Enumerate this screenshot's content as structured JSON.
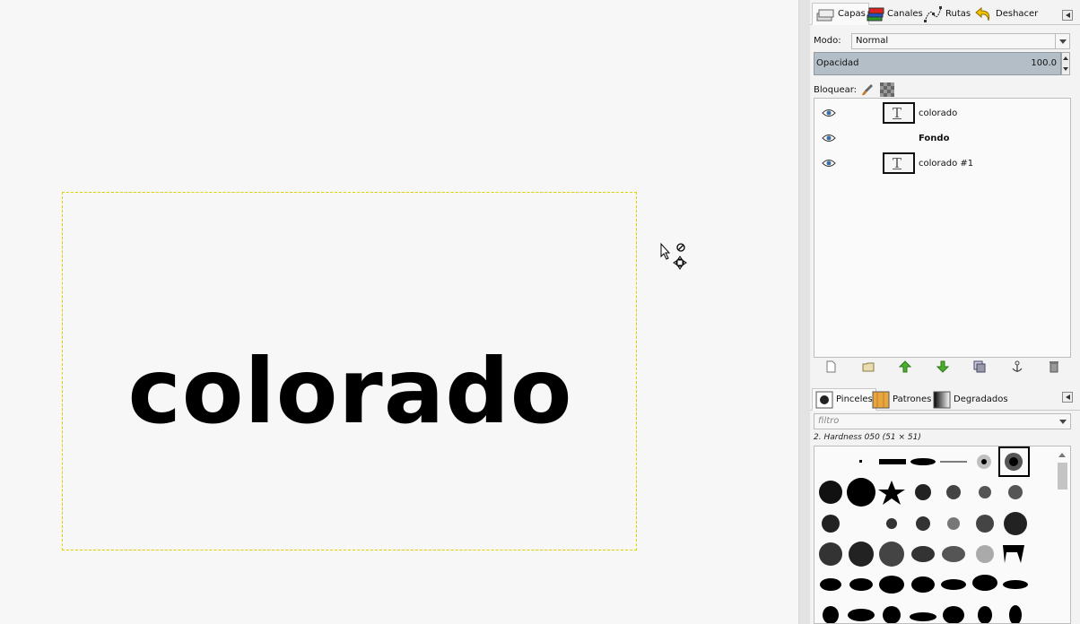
{
  "canvas": {
    "text": "colorado"
  },
  "layers_dock": {
    "tabs": [
      {
        "label": "Capas",
        "icon": "layers-icon"
      },
      {
        "label": "Canales",
        "icon": "channels-icon"
      },
      {
        "label": "Rutas",
        "icon": "paths-icon"
      },
      {
        "label": "Deshacer",
        "icon": "undo-icon"
      }
    ],
    "mode_label": "Modo:",
    "mode_value": "Normal",
    "opacity_label": "Opacidad",
    "opacity_value": "100.0",
    "lock_label": "Bloquear:",
    "layers": [
      {
        "name": "colorado",
        "has_thumb": true,
        "bold": false
      },
      {
        "name": "Fondo",
        "has_thumb": false,
        "bold": true
      },
      {
        "name": "colorado #1",
        "has_thumb": true,
        "bold": false
      }
    ],
    "buttons": [
      "new-layer-icon",
      "new-group-icon",
      "raise-icon",
      "lower-icon",
      "duplicate-icon",
      "anchor-icon",
      "delete-icon"
    ]
  },
  "brushes_dock": {
    "tabs": [
      {
        "label": "Pinceles",
        "icon": "brush-icon"
      },
      {
        "label": "Patrones",
        "icon": "pattern-icon"
      },
      {
        "label": "Degradados",
        "icon": "gradient-icon"
      }
    ],
    "filter_placeholder": "filtro",
    "selected_brush": "2. Hardness 050 (51 × 51)"
  },
  "colors": {
    "canvas_bg": "#f7f7f7",
    "opacity_bar": "#b4bec6",
    "boundary_yellow": "#e6d200"
  }
}
